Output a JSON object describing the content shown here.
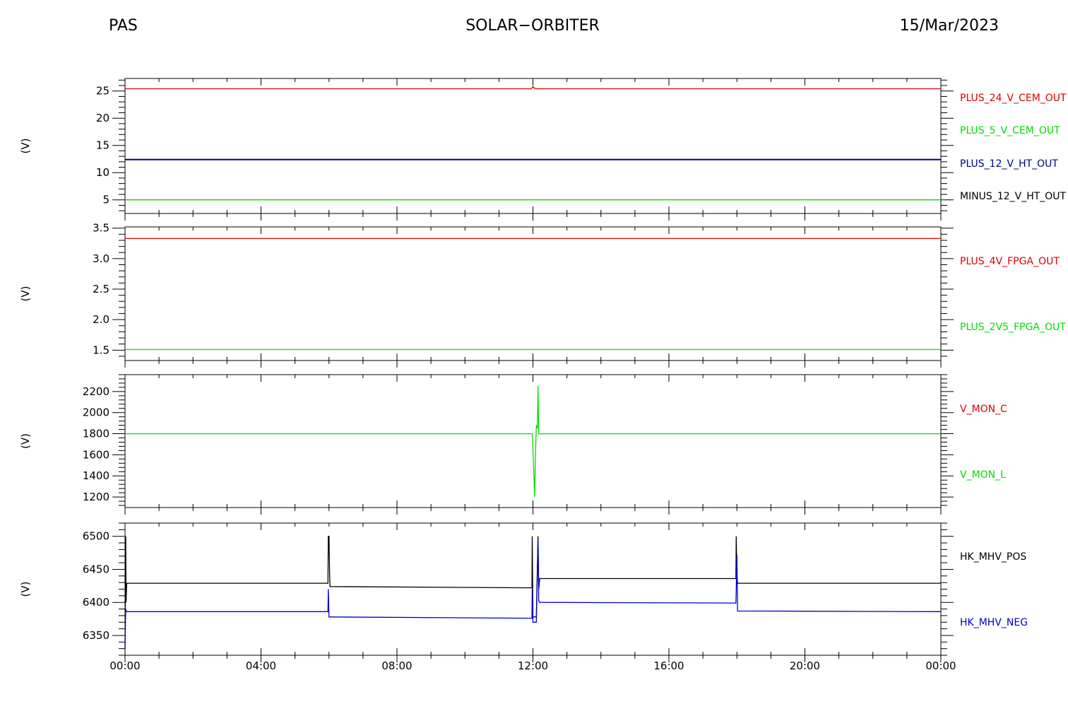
{
  "header": {
    "left": "PAS",
    "center": "SOLAR−ORBITER",
    "right": "15/Mar/2023"
  },
  "chart_data": [
    {
      "type": "line",
      "ylabel": "(V)",
      "ylim": [
        2.5,
        27.3
      ],
      "yticks": [
        5,
        10,
        15,
        20,
        25
      ],
      "ytick_labels": [
        "5",
        "10",
        "15",
        "20",
        "25"
      ],
      "xlim": [
        0,
        24
      ],
      "legend_placement": "right",
      "series": [
        {
          "name": "PLUS_24_V_CEM_OUT",
          "color": "#dd0000",
          "x": [
            0,
            6,
            11.95,
            12.0,
            12.05,
            12.1,
            18,
            24
          ],
          "y": [
            25.4,
            25.4,
            25.4,
            25.8,
            25.5,
            25.4,
            25.4,
            25.4
          ]
        },
        {
          "name": "PLUS_5_V_CEM_OUT",
          "color": "#00dd00",
          "x": [],
          "y": []
        },
        {
          "name": "PLUS_12_V_HT_OUT",
          "color": "#00008b",
          "x": [
            0,
            24
          ],
          "y": [
            12.4,
            12.4
          ]
        },
        {
          "name": "MINUS_12_V_HT_OUT",
          "color": "#000000",
          "x": [],
          "y": []
        },
        {
          "name": "",
          "color": "#00dd00",
          "x": [
            0,
            24
          ],
          "y": [
            5.0,
            5.0
          ]
        }
      ],
      "legend": [
        {
          "label": "PLUS_24_V_CEM_OUT",
          "color": "#dd0000"
        },
        {
          "label": "PLUS_5_V_CEM_OUT",
          "color": "#00dd00"
        },
        {
          "label": "PLUS_12_V_HT_OUT",
          "color": "#00008b"
        },
        {
          "label": "MINUS_12_V_HT_OUT",
          "color": "#000000"
        }
      ]
    },
    {
      "type": "line",
      "ylabel": "(V)",
      "ylim": [
        1.33,
        3.52
      ],
      "yticks": [
        1.5,
        2.0,
        2.5,
        3.0,
        3.5
      ],
      "ytick_labels": [
        "1.5",
        "2.0",
        "2.5",
        "3.0",
        "3.5"
      ],
      "xlim": [
        0,
        24
      ],
      "legend_placement": "right",
      "series": [
        {
          "name": "PLUS_4V_FPGA_OUT",
          "color": "#dd0000",
          "x": [
            0,
            24
          ],
          "y": [
            3.33,
            3.33
          ]
        },
        {
          "name": "PLUS_2V5_FPGA_OUT",
          "color": "#00dd00",
          "x": [
            0,
            24
          ],
          "y": [
            1.51,
            1.51
          ]
        }
      ],
      "legend": [
        {
          "label": "PLUS_4V_FPGA_OUT",
          "color": "#dd0000"
        },
        {
          "label": "PLUS_2V5_FPGA_OUT",
          "color": "#00dd00"
        }
      ]
    },
    {
      "type": "line",
      "ylabel": "(V)",
      "ylim": [
        1100,
        2360
      ],
      "yticks": [
        1200,
        1400,
        1600,
        1800,
        2000,
        2200
      ],
      "ytick_labels": [
        "1200",
        "1400",
        "1600",
        "1800",
        "2000",
        "2200"
      ],
      "xlim": [
        0,
        24
      ],
      "legend_placement": "right",
      "series": [
        {
          "name": "V_MON_C",
          "color": "#dd0000",
          "x": [],
          "y": []
        },
        {
          "name": "V_MON_L",
          "color": "#00dd00",
          "x": [
            0,
            11.98,
            11.99,
            12.05,
            12.08,
            12.1,
            12.13,
            12.15,
            12.17,
            24
          ],
          "y": [
            1800,
            1800,
            1760,
            1200,
            1650,
            1880,
            1850,
            2250,
            1800,
            1800
          ]
        }
      ],
      "legend": [
        {
          "label": "V_MON_C",
          "color": "#dd0000"
        },
        {
          "label": "V_MON_L",
          "color": "#00dd00"
        }
      ]
    },
    {
      "type": "line",
      "ylabel": "(V)",
      "ylim": [
        6320,
        6520
      ],
      "yticks": [
        6350,
        6400,
        6450,
        6500
      ],
      "ytick_labels": [
        "6350",
        "6400",
        "6450",
        "6500"
      ],
      "xlim": [
        0,
        24
      ],
      "xticks": [
        0,
        4,
        8,
        12,
        16,
        20,
        24
      ],
      "xtick_labels": [
        "00:00",
        "04:00",
        "08:00",
        "12:00",
        "16:00",
        "20:00",
        "00:00"
      ],
      "legend_placement": "right",
      "series": [
        {
          "name": "HK_MHV_POS",
          "color": "#000000",
          "x": [
            0,
            0.02,
            0.03,
            0.05,
            0.06,
            5.97,
            5.98,
            6.0,
            6.02,
            6.03,
            11.97,
            11.98,
            12.0,
            12.1,
            12.15,
            12.17,
            12.2,
            17.97,
            17.98,
            18.0,
            18.02,
            24
          ],
          "y": [
            6330,
            6500,
            6400,
            6429,
            6429,
            6429,
            6500,
            6500,
            6440,
            6424,
            6422,
            6500,
            6378,
            6378,
            6500,
            6420,
            6436,
            6436,
            6500,
            6440,
            6429,
            6429
          ]
        },
        {
          "name": "HK_MHV_NEG",
          "color": "#0000cc",
          "x": [
            0,
            0.02,
            0.04,
            5.97,
            5.98,
            6.0,
            6.02,
            11.97,
            11.98,
            12.0,
            12.1,
            12.15,
            12.17,
            12.2,
            17.97,
            17.98,
            18.0,
            18.02,
            24
          ],
          "y": [
            6335,
            6390,
            6386,
            6386,
            6420,
            6378,
            6378,
            6376,
            6420,
            6370,
            6370,
            6495,
            6402,
            6400,
            6399,
            6420,
            6472,
            6387,
            6386
          ]
        }
      ],
      "legend": [
        {
          "label": "HK_MHV_POS",
          "color": "#000000"
        },
        {
          "label": "HK_MHV_NEG",
          "color": "#0000cc"
        }
      ]
    }
  ]
}
